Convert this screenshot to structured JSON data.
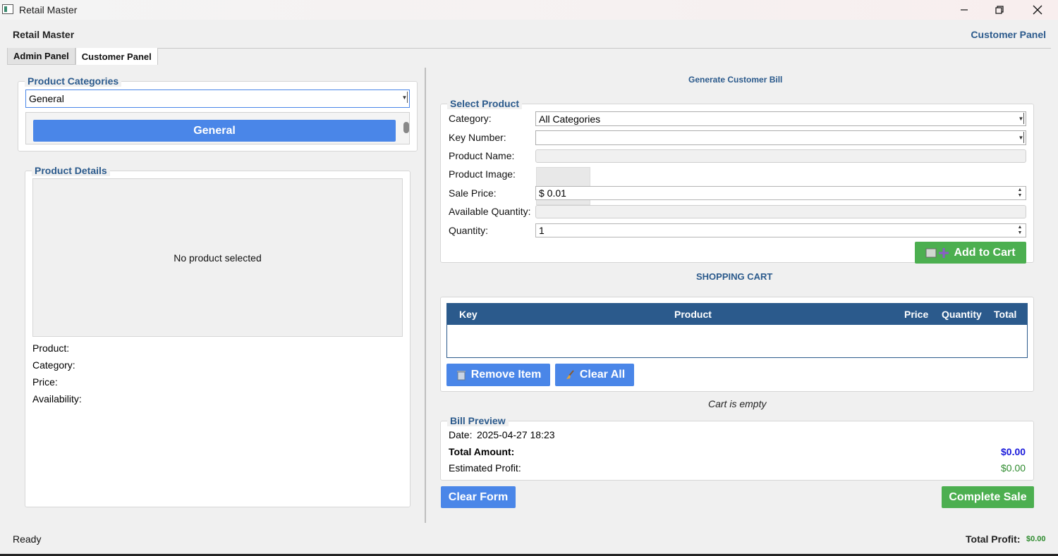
{
  "window": {
    "title": "Retail Master"
  },
  "header": {
    "app_name": "Retail Master",
    "panel_name": "Customer Panel"
  },
  "tabs": [
    {
      "label": "Admin Panel",
      "active": false
    },
    {
      "label": "Customer Panel",
      "active": true
    }
  ],
  "categories_panel": {
    "legend": "Product Categories",
    "selected_category": "General",
    "category_buttons": [
      "General"
    ]
  },
  "details_panel": {
    "legend": "Product Details",
    "placeholder": "No product selected",
    "labels": {
      "product": "Product:",
      "category": "Category:",
      "price": "Price:",
      "availability": "Availability:"
    }
  },
  "bill_panel": {
    "title": "Generate Customer Bill",
    "select_product": {
      "legend": "Select Product",
      "category_label": "Category:",
      "category_value": "All Categories",
      "key_label": "Key Number:",
      "key_value": "",
      "name_label": "Product Name:",
      "name_value": "",
      "image_label": "Product Image:",
      "price_label": "Sale Price:",
      "price_value": "$ 0.01",
      "available_label": "Available Quantity:",
      "available_value": "",
      "qty_label": "Quantity:",
      "qty_value": "1",
      "add_button": "Add to Cart"
    },
    "cart": {
      "title": "SHOPPING CART",
      "columns": [
        "Key",
        "Product",
        "Price",
        "Quantity",
        "Total"
      ],
      "rows": [],
      "remove_button": "Remove Item",
      "clear_button": "Clear All",
      "status": "Cart is empty"
    },
    "bill_preview": {
      "legend": "Bill Preview",
      "date_label": "Date:",
      "date_value": "2025-04-27 18:23",
      "total_label": "Total Amount:",
      "total_value": "$0.00",
      "profit_label": "Estimated Profit:",
      "profit_value": "$0.00"
    },
    "clear_form_button": "Clear Form",
    "complete_sale_button": "Complete Sale"
  },
  "statusbar": {
    "status": "Ready",
    "total_profit_label": "Total Profit:",
    "total_profit_value": "$0.00"
  },
  "colors": {
    "accent_blue": "#4a86e8",
    "header_blue": "#2b5a8c",
    "success_green": "#4caf50",
    "total_blue": "#1a1adb",
    "profit_green": "#2e8b2e"
  }
}
